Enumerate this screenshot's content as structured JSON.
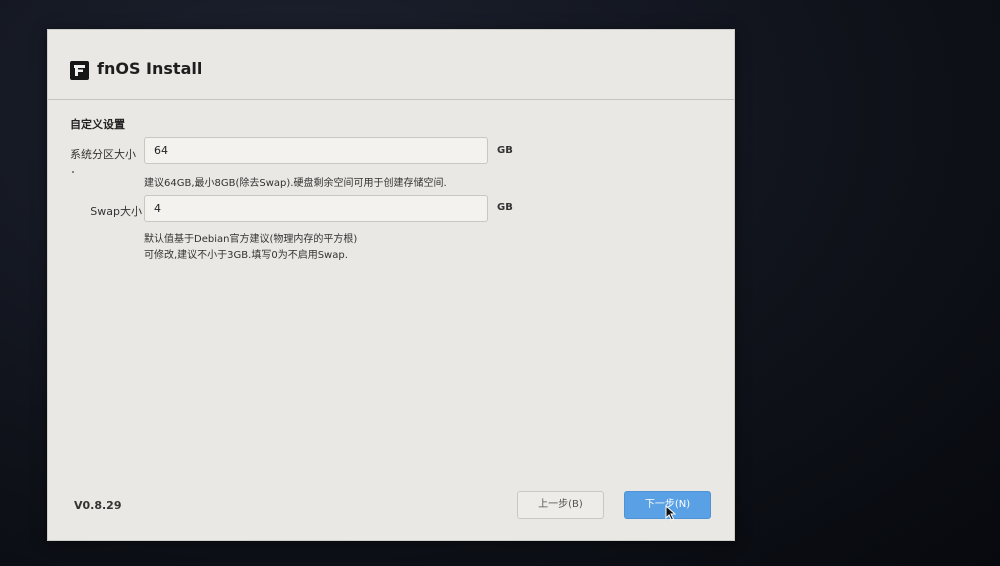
{
  "app": {
    "title": "fnOS Install"
  },
  "section": {
    "title": "自定义设置"
  },
  "system_partition": {
    "label": "系统分区大小",
    "value": "64",
    "unit": "GB",
    "hint": "建议64GB,最小8GB(除去Swap).硬盘剩余空间可用于创建存储空间."
  },
  "swap": {
    "label": "Swap大小",
    "value": "4",
    "unit": "GB",
    "hint_line1": "默认值基于Debian官方建议(物理内存的平方根)",
    "hint_line2": "可修改,建议不小于3GB.填写0为不启用Swap."
  },
  "footer": {
    "version": "V0.8.29",
    "prev_label": "上一步(B)",
    "next_label": "下一步(N)"
  },
  "colors": {
    "accent": "#5aa0e4",
    "window_bg": "#e9e8e4"
  },
  "icons": {
    "logo": "fnos-logo-icon",
    "cursor": "mouse-pointer-icon"
  }
}
